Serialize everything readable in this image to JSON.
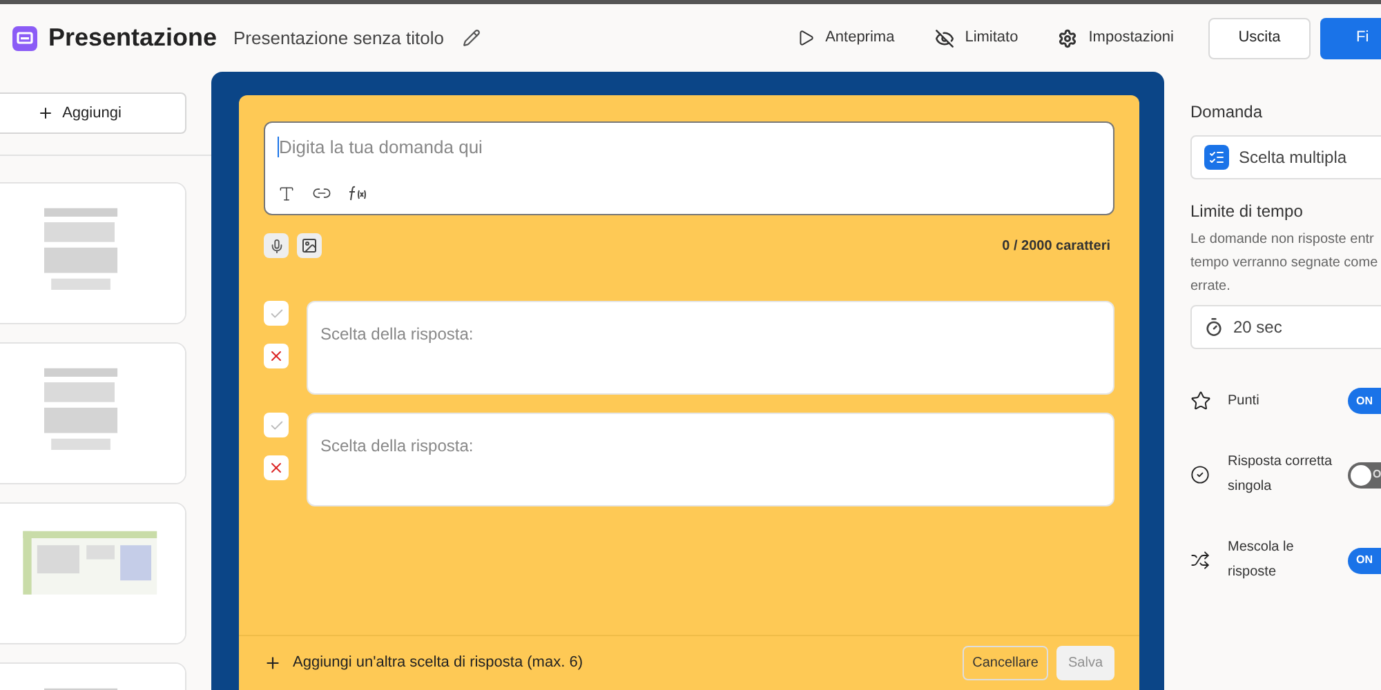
{
  "header": {
    "app_name": "Presentazione",
    "doc_title": "Presentazione senza titolo",
    "nav": [
      {
        "kind": "preview",
        "label": "Anteprima"
      },
      {
        "kind": "visibility",
        "label": "Limitato"
      },
      {
        "kind": "settings",
        "label": "Impostazioni"
      }
    ],
    "exit_button": "Uscita",
    "primary_button": "Fi"
  },
  "sidebar": {
    "add_button": "Aggiungi"
  },
  "editor": {
    "question_placeholder": "Digita la tua domanda qui",
    "char_count": "0 / 2000 caratteri",
    "answers": [
      {
        "placeholder": "Scelta della risposta:",
        "correct": false
      },
      {
        "placeholder": "Scelta della risposta:",
        "correct": false
      }
    ],
    "add_answer": "Aggiungi un'altra scelta di risposta (max. 6)",
    "cancel_button": "Cancellare",
    "save_button": "Salva"
  },
  "settings": {
    "question_label": "Domanda",
    "question_type": "Scelta multipla",
    "time_label": "Limite di tempo",
    "time_description": [
      "Le domande non risposte entr",
      "tempo verranno segnate come",
      "errate."
    ],
    "time_value": "20 sec",
    "toggles": [
      {
        "kind": "points",
        "label": "Punti",
        "on": true,
        "switch_text": "ON"
      },
      {
        "kind": "single",
        "label": "Risposta corretta singola",
        "on": false,
        "switch_text": "O"
      },
      {
        "kind": "shuffle",
        "label": "Mescola le risposte",
        "on": true,
        "switch_text": "ON"
      }
    ]
  }
}
